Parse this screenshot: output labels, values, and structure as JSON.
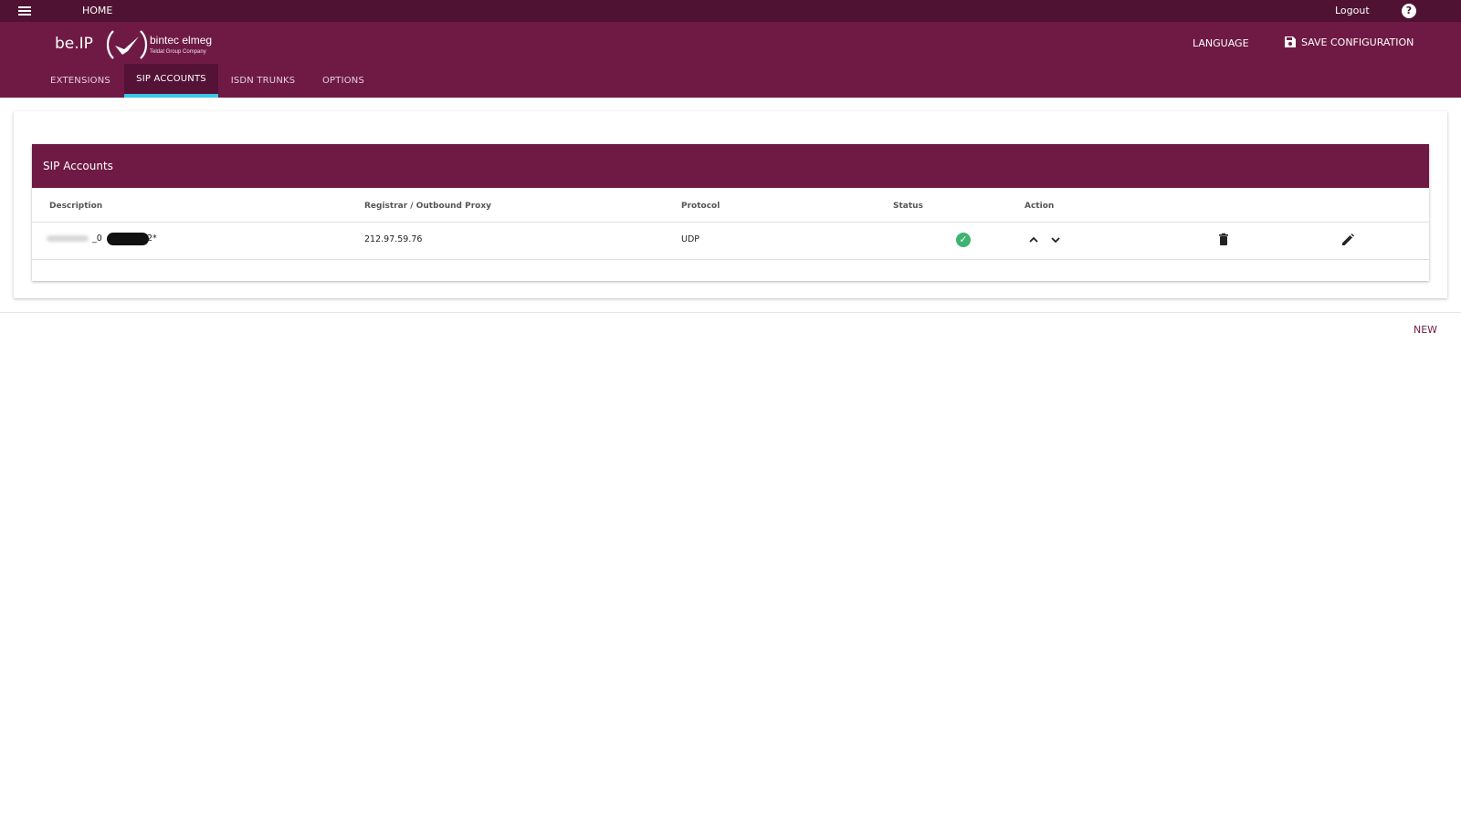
{
  "topbar": {
    "home_label": "HOME",
    "logout_label": "Logout",
    "help_symbol": "?"
  },
  "header": {
    "product_name": "be.IP",
    "brand_text": "bintec elmeg",
    "brand_subtext": "Teldat Group Company",
    "language_label": "LANGUAGE",
    "save_label": "SAVE CONFIGURATION"
  },
  "tabs": [
    {
      "label": "EXTENSIONS",
      "active": false
    },
    {
      "label": "SIP ACCOUNTS",
      "active": true
    },
    {
      "label": "ISDN TRUNKS",
      "active": false
    },
    {
      "label": "OPTIONS",
      "active": false
    }
  ],
  "panel": {
    "title": "SIP Accounts",
    "columns": [
      "Description",
      "Registrar / Outbound Proxy",
      "Protocol",
      "Status",
      "Action"
    ],
    "rows": [
      {
        "description_visible": "_0",
        "description_suffix": "2*",
        "registrar": "212.97.59.76",
        "protocol": "UDP",
        "status": "ok"
      }
    ]
  },
  "footer": {
    "new_label": "NEW"
  },
  "colors": {
    "accent": "#6e1a45",
    "topbar": "#4f1232",
    "tab_indicator": "#3cc6ea",
    "status_ok": "#3cb371"
  },
  "icons": [
    "menu-icon",
    "help-icon",
    "save-icon",
    "check-circle-icon",
    "chevron-up-icon",
    "chevron-down-icon",
    "trash-icon",
    "pencil-icon"
  ]
}
